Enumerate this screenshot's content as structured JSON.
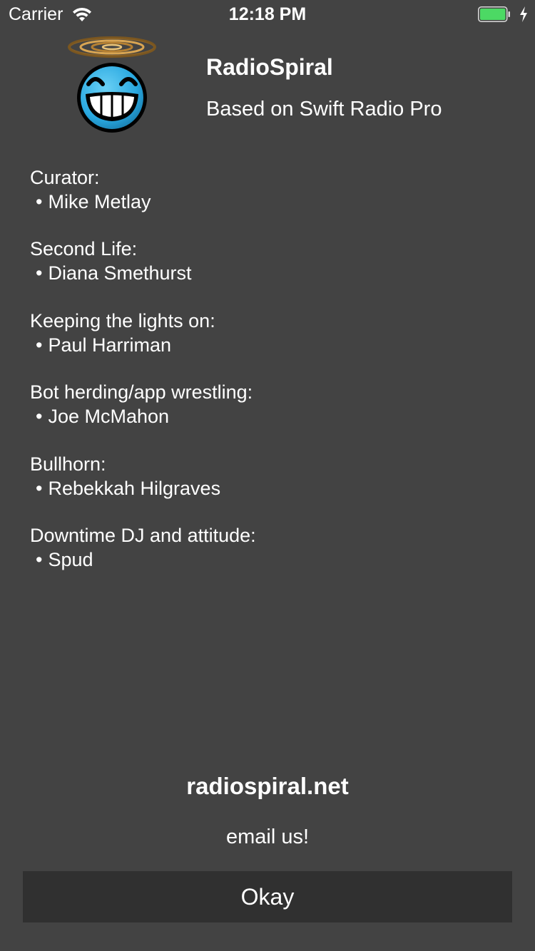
{
  "status_bar": {
    "carrier": "Carrier",
    "time": "12:18 PM",
    "battery_level": 1.0,
    "battery_color": "#4cd964"
  },
  "header": {
    "title": "RadioSpiral",
    "subtitle": "Based on Swift Radio Pro",
    "logo_icon": "grinning-face-spiral-halo-icon"
  },
  "credits": [
    {
      "role": "Curator:",
      "name": "Mike Metlay"
    },
    {
      "role": "Second Life:",
      "name": "Diana Smethurst"
    },
    {
      "role": "Keeping the lights on:",
      "name": "Paul Harriman"
    },
    {
      "role": "Bot herding/app wrestling:",
      "name": "Joe McMahon"
    },
    {
      "role": "Bullhorn:",
      "name": "Rebekkah Hilgraves"
    },
    {
      "role": "Downtime DJ and attitude:",
      "name": "Spud"
    }
  ],
  "bullet": "•",
  "footer": {
    "website": "radiospiral.net",
    "email": "email us!",
    "okay_label": "Okay"
  },
  "colors": {
    "background": "#434343",
    "button_background": "#303030",
    "text": "#ffffff",
    "logo_face": "#29a8e0"
  }
}
